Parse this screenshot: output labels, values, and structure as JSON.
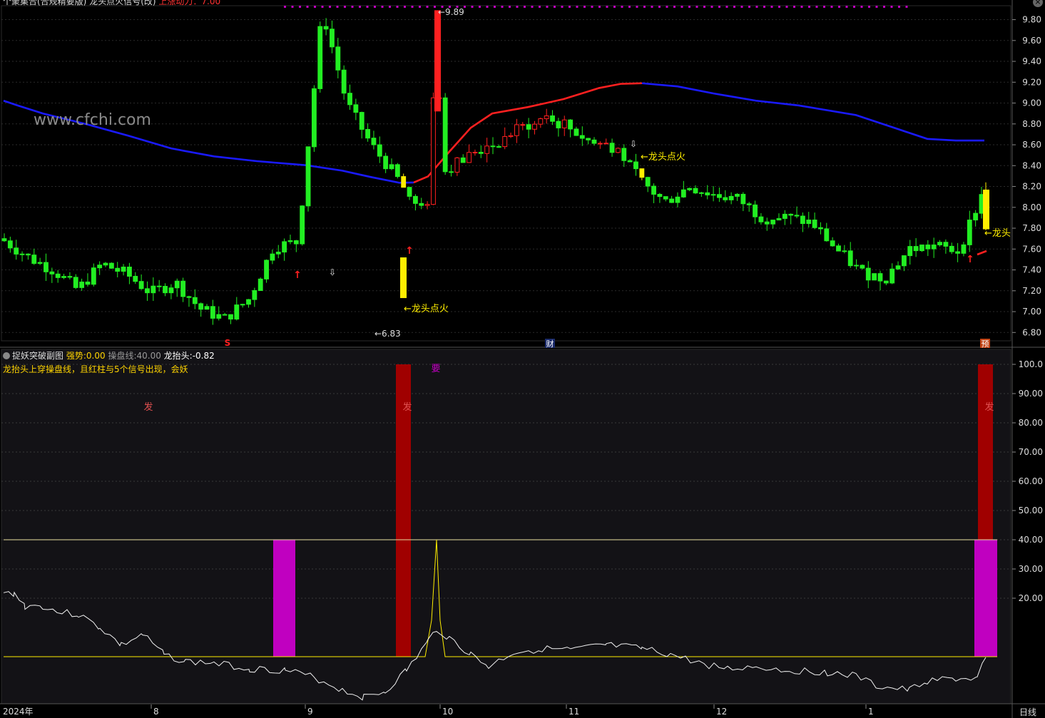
{
  "header": {
    "main_title_partial": "个聚集合(合规精要版)",
    "main_second": "龙头点火信号(改)",
    "main_value_partial": "上涨动力：7.00"
  },
  "watermark": "www.cfchi.com",
  "sub_panel": {
    "name": "捉妖突破副图",
    "strength_label": "强势:",
    "strength_value": "0.00",
    "control_label": "操盘线:",
    "control_value": "40.00",
    "dragon_label": "龙抬头:",
    "dragon_value": "-0.82",
    "note": "龙抬头上穿操盘线，且红柱与5个信号出现，会妖"
  },
  "x_axis": {
    "year": "2024年",
    "months": [
      "8",
      "9",
      "10",
      "11",
      "12",
      "1"
    ]
  },
  "period_label": "日线",
  "colors": {
    "up": "#ff2020",
    "down": "#22ee22",
    "ma": "#1a1aff",
    "signal": "#ffee00",
    "magenta": "#c000c0",
    "darkred": "#a00000"
  },
  "chart_data": [
    {
      "type": "candlestick",
      "panel": "main",
      "y_ticks": [
        "9.80",
        "9.60",
        "9.40",
        "9.20",
        "9.00",
        "8.80",
        "8.60",
        "8.40",
        "8.20",
        "8.00",
        "7.80",
        "7.60",
        "7.40",
        "7.20",
        "7.00",
        "6.80"
      ],
      "ylim": [
        6.72,
        9.92
      ],
      "annotations": [
        {
          "text": "9.89",
          "type": "high"
        },
        {
          "text": "6.83",
          "type": "low"
        },
        {
          "text": "龙头点火",
          "type": "signal"
        },
        {
          "text": "龙头点火",
          "type": "signal"
        },
        {
          "text": "龙头",
          "type": "signal"
        }
      ],
      "event_markers": [
        "S",
        "财",
        "预"
      ],
      "series": [
        {
          "name": "close",
          "values": [
            7.68,
            7.52,
            7.4,
            7.21,
            7.46,
            7.36,
            7.18,
            7.28,
            7.03,
            6.93,
            7.12,
            7.62,
            7.67,
            9.89,
            9.0,
            8.6,
            8.3,
            7.95,
            8.35,
            8.5,
            8.6,
            8.75,
            8.85,
            8.78,
            8.62,
            8.58,
            8.25,
            8.05,
            8.2,
            8.12,
            8.08,
            7.9,
            7.9,
            7.85,
            7.6,
            7.38,
            7.32,
            7.6,
            7.63,
            7.58,
            8.15
          ]
        }
      ]
    },
    {
      "type": "bar+line",
      "panel": "sub",
      "y_ticks": [
        "100.0",
        "90.00",
        "80.00",
        "70.00",
        "60.00",
        "50.00",
        "40.00",
        "30.00",
        "20.00"
      ],
      "ylim": [
        0,
        100
      ],
      "bar_labels": [
        "发",
        "发",
        "要",
        "发"
      ],
      "series": [
        {
          "name": "操盘线",
          "value": 40
        },
        {
          "name": "强势",
          "value": 0
        },
        {
          "name": "龙抬头",
          "value": -0.82
        }
      ]
    }
  ]
}
